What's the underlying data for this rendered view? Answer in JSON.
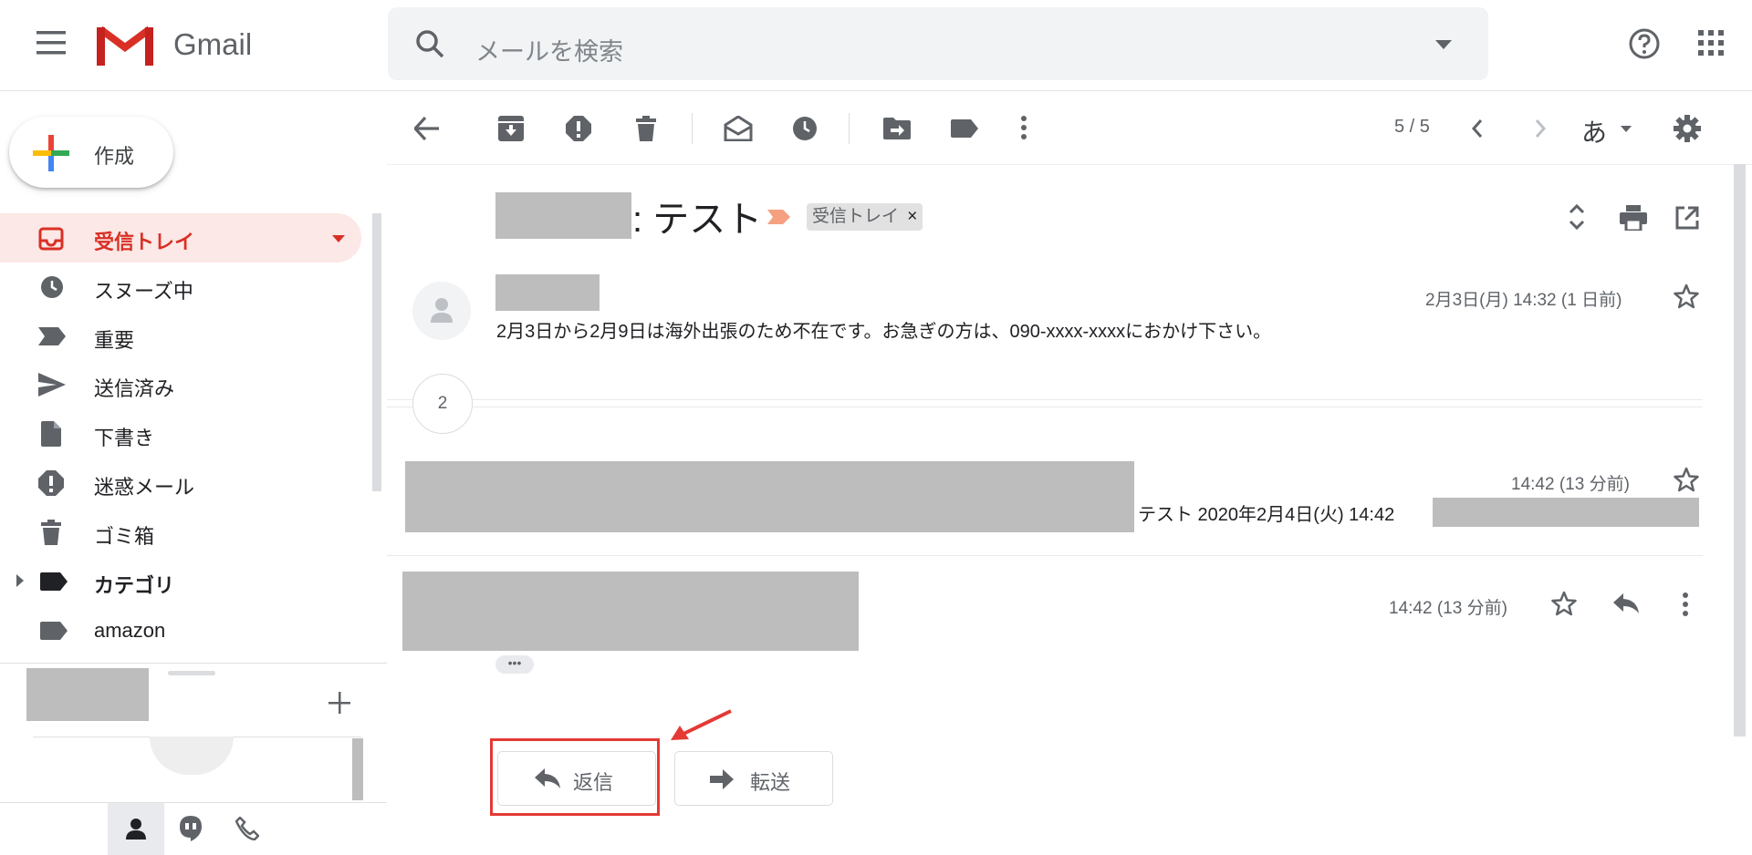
{
  "app": {
    "name": "Gmail"
  },
  "search": {
    "placeholder": "メールを検索"
  },
  "compose": {
    "label": "作成"
  },
  "sidebar": {
    "items": [
      {
        "label": "受信トレイ",
        "icon": "inbox-icon",
        "active": true
      },
      {
        "label": "スヌーズ中",
        "icon": "clock-icon"
      },
      {
        "label": "重要",
        "icon": "important-icon"
      },
      {
        "label": "送信済み",
        "icon": "send-icon"
      },
      {
        "label": "下書き",
        "icon": "draft-icon"
      },
      {
        "label": "迷惑メール",
        "icon": "spam-icon"
      },
      {
        "label": "ゴミ箱",
        "icon": "trash-icon"
      },
      {
        "label": "カテゴリ",
        "icon": "label-icon"
      },
      {
        "label": "amazon",
        "icon": "label-icon"
      }
    ]
  },
  "toolbar": {
    "pager": "5 / 5",
    "input_tool": "あ"
  },
  "thread": {
    "subject": ": テスト",
    "label_chip": "受信トレイ",
    "label_chip_close": "×",
    "messages": [
      {
        "date": "2月3日(月) 14:32 (1 日前)",
        "snippet": "2月3日から2月9日は海外出張のため不在です。お急ぎの方は、090-xxxx-xxxxにおかけ下さい。"
      },
      {
        "collapsed_count": "2"
      },
      {
        "date": "14:42 (13 分前)",
        "snippet": "テスト 2020年2月4日(火) 14:42"
      },
      {
        "date": "14:42 (13 分前)"
      }
    ],
    "show_trimmed": "•••"
  },
  "actions": {
    "reply": "返信",
    "forward": "転送"
  },
  "colors": {
    "accent_red": "#d93025",
    "highlight_box": "#e53935",
    "inbox_active_bg": "#fce8e6"
  }
}
